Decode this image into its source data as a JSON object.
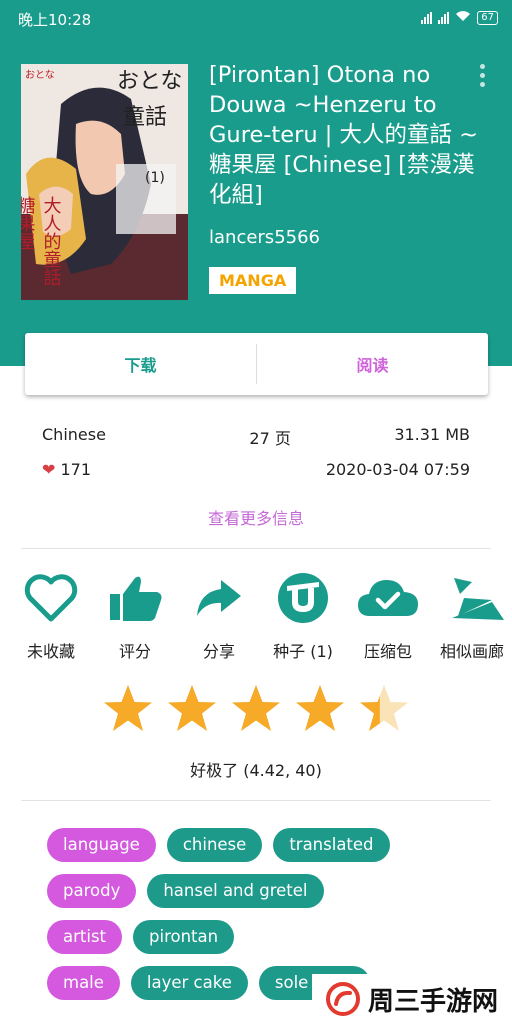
{
  "status_bar": {
    "time": "晚上10:28",
    "battery": "67"
  },
  "gallery": {
    "title": "[Pirontan] Otona no Douwa ~Henzeru to Gure-teru | 大人的童話 ~ 糖果屋 [Chinese] [禁漫漢化組]",
    "uploader": "lancers5566",
    "category": "MANGA",
    "cover_text": {
      "top": "おとな",
      "mid": "童話",
      "side": "大人的童話",
      "left": "糖果屋",
      "vol": "(1)"
    }
  },
  "actions": {
    "download": "下载",
    "read": "阅读",
    "download_color": "#1a9c8c",
    "read_color": "#cf63d9"
  },
  "info": {
    "language": "Chinese",
    "pages": "27 页",
    "size": "31.31 MB",
    "favorites": "171",
    "posted": "2020-03-04 07:59",
    "more_info": "查看更多信息"
  },
  "features": [
    {
      "label": "未收藏",
      "icon": "heart-outline-icon"
    },
    {
      "label": "评分",
      "icon": "thumbs-up-icon"
    },
    {
      "label": "分享",
      "icon": "share-arrow-icon"
    },
    {
      "label": "种子 (1)",
      "icon": "torrent-icon"
    },
    {
      "label": "压缩包",
      "icon": "cloud-check-icon"
    },
    {
      "label": "相似画廊",
      "icon": "similar-gallery-icon"
    }
  ],
  "rating": {
    "stars": 4.42,
    "text": "好极了 (4.42, 40)",
    "star_color": "#f6aa27"
  },
  "tags": [
    {
      "namespace": "language",
      "values": [
        "chinese",
        "translated"
      ]
    },
    {
      "namespace": "parody",
      "values": [
        "hansel and gretel"
      ]
    },
    {
      "namespace": "artist",
      "values": [
        "pirontan"
      ]
    },
    {
      "namespace": "male",
      "values": [
        "layer cake",
        "sole male"
      ]
    }
  ],
  "colors": {
    "primary": "#199c8c",
    "accent": "#d459df"
  },
  "watermark": {
    "text": "周三手游网"
  }
}
